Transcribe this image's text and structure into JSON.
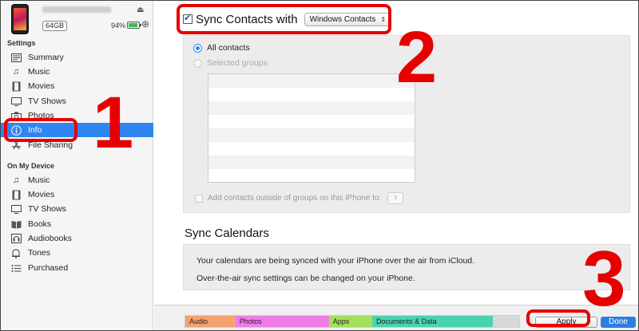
{
  "device": {
    "capacity": "64GB",
    "battery_pct": "94%",
    "battery_level": 0.94
  },
  "sidebar": {
    "settings_title": "Settings",
    "settings_items": [
      {
        "label": "Summary",
        "icon": "summary-icon"
      },
      {
        "label": "Music",
        "icon": "music-note-icon"
      },
      {
        "label": "Movies",
        "icon": "film-icon"
      },
      {
        "label": "TV Shows",
        "icon": "tv-icon"
      },
      {
        "label": "Photos",
        "icon": "camera-icon"
      },
      {
        "label": "Info",
        "icon": "info-icon",
        "active": true
      },
      {
        "label": "File Sharing",
        "icon": "app-store-icon"
      }
    ],
    "device_title": "On My Device",
    "device_items": [
      {
        "label": "Music",
        "icon": "music-note-icon"
      },
      {
        "label": "Movies",
        "icon": "film-icon"
      },
      {
        "label": "TV Shows",
        "icon": "tv-icon"
      },
      {
        "label": "Books",
        "icon": "book-icon"
      },
      {
        "label": "Audiobooks",
        "icon": "audiobook-icon"
      },
      {
        "label": "Tones",
        "icon": "bell-icon"
      },
      {
        "label": "Purchased",
        "icon": "list-icon"
      }
    ]
  },
  "contacts": {
    "sync_label": "Sync Contacts with",
    "sync_checked": true,
    "selected_source": "Windows Contacts",
    "all_contacts_label": "All contacts",
    "selected_groups_label": "Selected groups",
    "add_outside_label": "Add contacts outside of groups on this iPhone to:"
  },
  "calendars": {
    "title": "Sync Calendars",
    "line1": "Your calendars are being synced with your iPhone over the air from iCloud.",
    "line2": "Over-the-air sync settings can be changed on your iPhone."
  },
  "storage": {
    "segments": [
      {
        "label": "Audio",
        "color": "#f4a26f",
        "share": 0.15
      },
      {
        "label": "Photos",
        "color": "#f07ce8",
        "share": 0.28
      },
      {
        "label": "Apps",
        "color": "#a3e05a",
        "share": 0.13
      },
      {
        "label": "Documents & Data",
        "color": "#4bd3b0",
        "share": 0.36
      },
      {
        "label": "",
        "color": "#d8d8d8",
        "share": 0.08
      }
    ]
  },
  "buttons": {
    "apply": "Apply",
    "done": "Done"
  },
  "annotations": {
    "step1": "1",
    "step2": "2",
    "step3": "3",
    "color": "#e60000"
  }
}
